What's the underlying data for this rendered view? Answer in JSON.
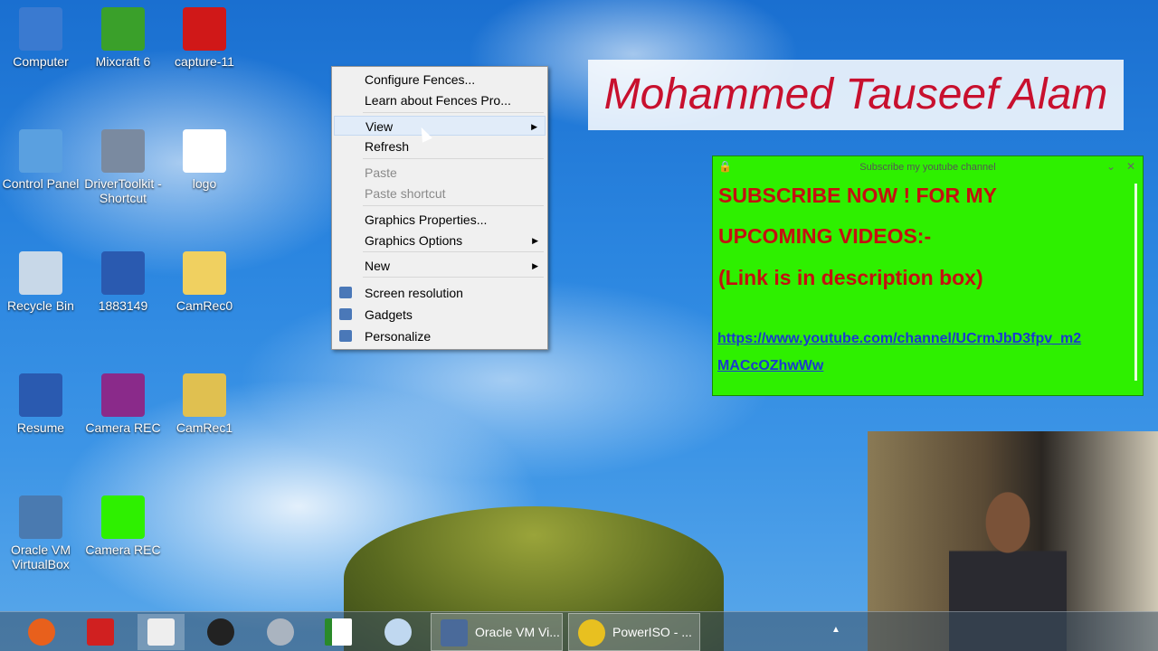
{
  "desktop_icons": [
    {
      "label": "Computer",
      "color": "#3a7ad0"
    },
    {
      "label": "Mixcraft 6",
      "color": "#3aa02a"
    },
    {
      "label": "capture-11",
      "color": "#d01818"
    },
    {
      "label": "Control Panel",
      "color": "#5aa0e0"
    },
    {
      "label": "DriverToolkit - Shortcut",
      "color": "#7a8aa0"
    },
    {
      "label": "logo",
      "color": "#ffffff"
    },
    {
      "label": "Recycle Bin",
      "color": "#c8d8e8"
    },
    {
      "label": "1883149",
      "color": "#2a5ab0"
    },
    {
      "label": "CamRec0",
      "color": "#f0d060"
    },
    {
      "label": "Resume",
      "color": "#2a5ab0"
    },
    {
      "label": "Camera REC",
      "color": "#8a2a8a"
    },
    {
      "label": "CamRec1",
      "color": "#e0c050"
    },
    {
      "label": "Oracle VM VirtualBox",
      "color": "#4a7ab0"
    },
    {
      "label": "Camera REC",
      "color": "#2ef000"
    }
  ],
  "context_menu": {
    "items": [
      {
        "label": "Configure Fences...",
        "disabled": false
      },
      {
        "label": "Learn about Fences Pro...",
        "disabled": false
      },
      {
        "label": "View",
        "submenu": true,
        "highlighted": true
      },
      {
        "label": "Refresh"
      },
      {
        "label": "Paste",
        "disabled": true
      },
      {
        "label": "Paste shortcut",
        "disabled": true
      },
      {
        "label": "Graphics Properties..."
      },
      {
        "label": "Graphics Options",
        "submenu": true
      },
      {
        "label": "New",
        "submenu": true
      },
      {
        "label": "Screen resolution",
        "icon": "screen-icon"
      },
      {
        "label": "Gadgets",
        "icon": "gadgets-icon"
      },
      {
        "label": "Personalize",
        "icon": "personalize-icon"
      }
    ],
    "arrow": "▶"
  },
  "banner_name": "Mohammed Tauseef Alam",
  "subscribe_fence": {
    "title": "Subscribe my youtube channel",
    "line1": "SUBSCRIBE  NOW !  FOR MY",
    "line2": "UPCOMING VIDEOS:-",
    "line3": "(Link is in description box)",
    "link1": "https://www.youtube.com/channel/UCrmJbD3fpv_m2",
    "link2": "MACcOZhwWw",
    "close": "✕",
    "collapse": "⌄"
  },
  "taskbar": {
    "windows": [
      {
        "label": "Oracle VM Vi..."
      },
      {
        "label": "PowerISO - ..."
      }
    ],
    "tray_arrow": "▲"
  }
}
